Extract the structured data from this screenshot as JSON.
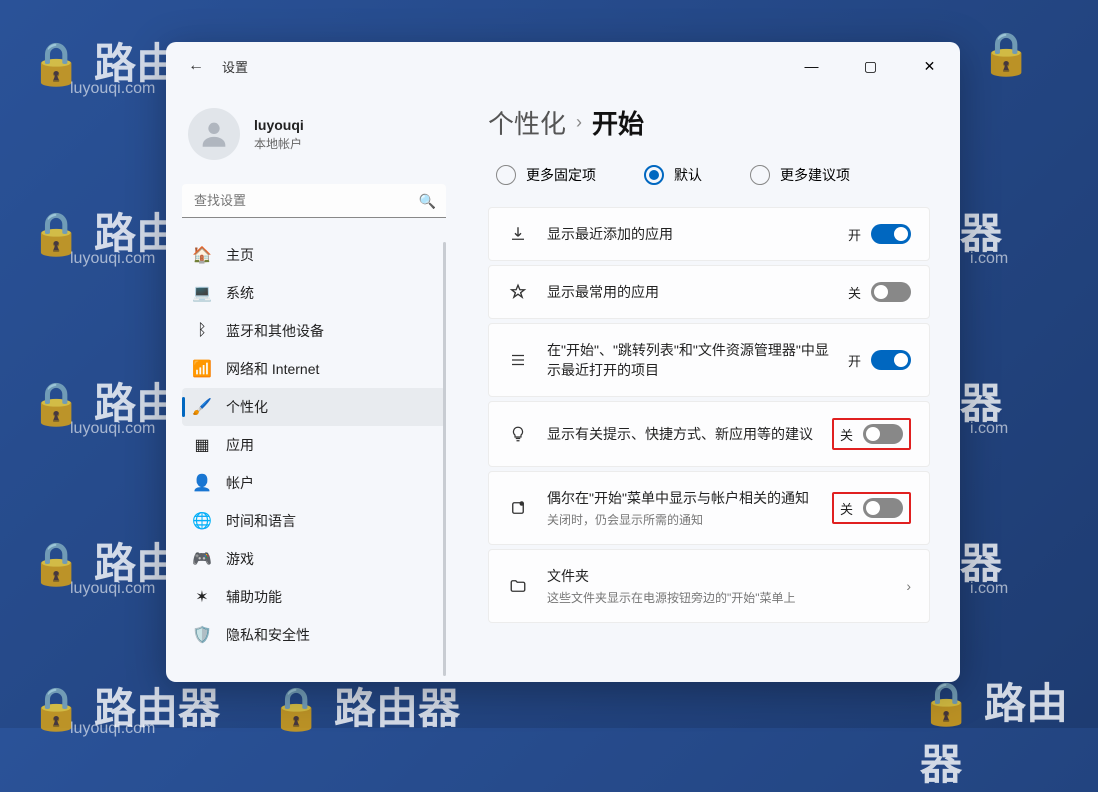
{
  "watermark": {
    "text": "路由器",
    "sub": "luyouqi.com"
  },
  "window": {
    "title": "设置",
    "controls": {
      "min": "—",
      "max": "▢",
      "close": "✕"
    }
  },
  "profile": {
    "name": "luyouqi",
    "type": "本地帐户"
  },
  "search": {
    "placeholder": "查找设置"
  },
  "nav": {
    "items": [
      {
        "label": "主页",
        "icon": "🏠"
      },
      {
        "label": "系统",
        "icon": "💻"
      },
      {
        "label": "蓝牙和其他设备",
        "icon": "ᛒ"
      },
      {
        "label": "网络和 Internet",
        "icon": "📶"
      },
      {
        "label": "个性化",
        "icon": "🖌️"
      },
      {
        "label": "应用",
        "icon": "▦"
      },
      {
        "label": "帐户",
        "icon": "👤"
      },
      {
        "label": "时间和语言",
        "icon": "🌐"
      },
      {
        "label": "游戏",
        "icon": "🎮"
      },
      {
        "label": "辅助功能",
        "icon": "✶"
      },
      {
        "label": "隐私和安全性",
        "icon": "🛡️"
      }
    ],
    "active_index": 4
  },
  "breadcrumb": {
    "parent": "个性化",
    "sep": "›",
    "current": "开始"
  },
  "radios": {
    "options": [
      {
        "label": "更多固定项",
        "selected": false
      },
      {
        "label": "默认",
        "selected": true
      },
      {
        "label": "更多建议项",
        "selected": false
      }
    ]
  },
  "cards": [
    {
      "icon": "download",
      "title": "显示最近添加的应用",
      "state": "on",
      "state_label": "开",
      "highlight": false
    },
    {
      "icon": "star",
      "title": "显示最常用的应用",
      "state": "off",
      "state_label": "关",
      "highlight": false
    },
    {
      "icon": "list",
      "title": "在\"开始\"、\"跳转列表\"和\"文件资源管理器\"中显示最近打开的项目",
      "state": "on",
      "state_label": "开",
      "highlight": false
    },
    {
      "icon": "bulb",
      "title": "显示有关提示、快捷方式、新应用等的建议",
      "state": "off",
      "state_label": "关",
      "highlight": true
    },
    {
      "icon": "bell",
      "title": "偶尔在\"开始\"菜单中显示与帐户相关的通知",
      "sub": "关闭时，仍会显示所需的通知",
      "state": "off",
      "state_label": "关",
      "highlight": true
    },
    {
      "icon": "folder",
      "title": "文件夹",
      "sub": "这些文件夹显示在电源按钮旁边的\"开始\"菜单上",
      "type": "nav"
    }
  ]
}
